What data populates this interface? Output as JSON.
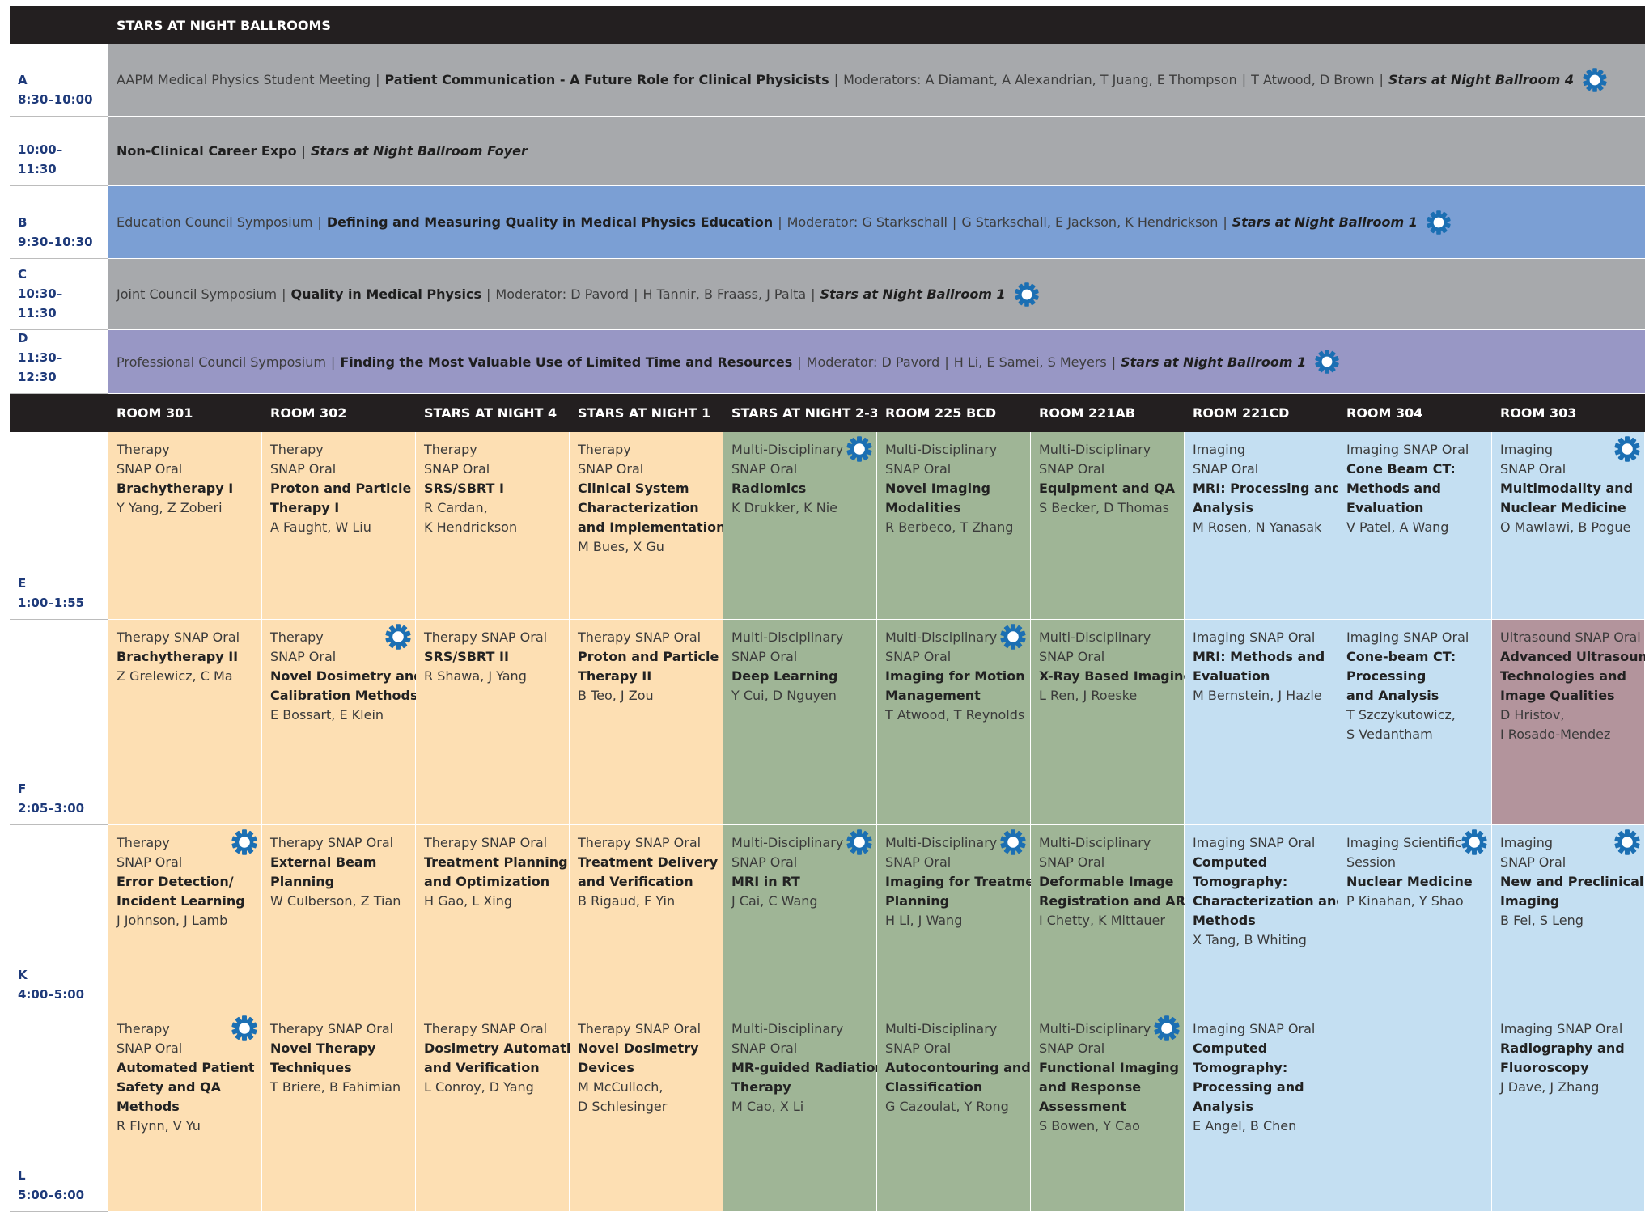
{
  "header": {
    "title": "STARS AT NIGHT BALLROOMS"
  },
  "colors": {
    "header_bg": "#231f20",
    "time_text": "#1e3a7a",
    "grey_band": "#a7a9ac",
    "blue_band": "#7b9fd4",
    "purple_band": "#9897c5",
    "therapy": "#fddfb3",
    "multidisciplinary": "#9fb596",
    "imaging": "#c4dff2",
    "ultrasound": "#b3949c",
    "gear": "#1b6fb3"
  },
  "time_slots": [
    {
      "letter": "A",
      "time": "8:30–10:00"
    },
    {
      "letter": "",
      "time": "10:00–11:30"
    },
    {
      "letter": "B",
      "time": "9:30–10:30"
    },
    {
      "letter": "C",
      "time": "10:30–11:30"
    },
    {
      "letter": "D",
      "time": "11:30–12:30"
    },
    {
      "letter": "E",
      "time": "1:00–1:55"
    },
    {
      "letter": "F",
      "time": "2:05–3:00"
    },
    {
      "letter": "K",
      "time": "4:00–5:00"
    },
    {
      "letter": "L",
      "time": "5:00–6:00"
    }
  ],
  "bands": [
    {
      "type": "AAPM Medical Physics Student Meeting",
      "title": "Patient Communication - A Future Role for Clinical Physicists",
      "moderator": "Moderators: A Diamant, A Alexandrian, T Juang, E Thompson",
      "speakers": "T Atwood, D Brown",
      "location": "Stars at Night Ballroom 4",
      "gear": true
    },
    {
      "type": "",
      "title": "Non-Clinical Career Expo",
      "moderator": "",
      "speakers": "",
      "location": "Stars at Night Ballroom Foyer",
      "gear": false
    },
    {
      "type": "Education Council Symposium",
      "title": "Defining and Measuring Quality in Medical Physics Education",
      "moderator": "Moderator: G Starkschall",
      "speakers": "G Starkschall, E Jackson, K Hendrickson",
      "location": "Stars at Night Ballroom 1",
      "gear": true
    },
    {
      "type": "Joint Council Symposium",
      "title": "Quality in Medical Physics",
      "moderator": "Moderator: D Pavord",
      "speakers": "H Tannir, B Fraass, J Palta",
      "location": "Stars at Night Ballroom 1",
      "gear": true
    },
    {
      "type": "Professional Council Symposium",
      "title": "Finding the Most Valuable Use of Limited Time and Resources",
      "moderator": "Moderator: D Pavord",
      "speakers": "H Li, E Samei, S Meyers",
      "location": "Stars at Night Ballroom 1",
      "gear": true
    }
  ],
  "rooms": [
    "ROOM 301",
    "ROOM 302",
    "STARS AT NIGHT 4",
    "STARS AT NIGHT 1",
    "STARS AT NIGHT 2-3",
    "ROOM 225 BCD",
    "ROOM 221AB",
    "ROOM 221CD",
    "ROOM 304",
    "ROOM 303"
  ],
  "sessions": [
    {
      "row": 0,
      "col": 0,
      "cat": "therapy",
      "gear": false,
      "type": [
        "Therapy",
        "SNAP Oral"
      ],
      "title": [
        "Brachytherapy I"
      ],
      "speakers": [
        "Y Yang, Z Zoberi"
      ]
    },
    {
      "row": 0,
      "col": 1,
      "cat": "therapy",
      "gear": false,
      "type": [
        "Therapy",
        "SNAP Oral"
      ],
      "title": [
        "Proton and Particle",
        "Therapy I"
      ],
      "speakers": [
        "A Faught, W Liu"
      ]
    },
    {
      "row": 0,
      "col": 2,
      "cat": "therapy",
      "gear": false,
      "type": [
        "Therapy",
        "SNAP Oral"
      ],
      "title": [
        "SRS/SBRT I"
      ],
      "speakers": [
        "R Cardan,",
        "K Hendrickson"
      ]
    },
    {
      "row": 0,
      "col": 3,
      "cat": "therapy",
      "gear": false,
      "type": [
        "Therapy",
        "SNAP Oral"
      ],
      "title": [
        "Clinical System",
        "Characterization",
        "and Implementation"
      ],
      "speakers": [
        "M Bues, X Gu"
      ]
    },
    {
      "row": 0,
      "col": 4,
      "cat": "multidisciplinary",
      "gear": true,
      "type": [
        "Multi-Disciplinary",
        "SNAP Oral"
      ],
      "title": [
        "Radiomics"
      ],
      "speakers": [
        "K Drukker, K Nie"
      ]
    },
    {
      "row": 0,
      "col": 5,
      "cat": "multidisciplinary",
      "gear": false,
      "type": [
        "Multi-Disciplinary",
        "SNAP Oral"
      ],
      "title": [
        "Novel Imaging",
        "Modalities"
      ],
      "speakers": [
        "R Berbeco, T Zhang"
      ]
    },
    {
      "row": 0,
      "col": 6,
      "cat": "multidisciplinary",
      "gear": false,
      "type": [
        "Multi-Disciplinary",
        "SNAP Oral"
      ],
      "title": [
        "Equipment and QA"
      ],
      "speakers": [
        "S Becker, D Thomas"
      ]
    },
    {
      "row": 0,
      "col": 7,
      "cat": "imaging",
      "gear": false,
      "type": [
        "Imaging",
        "SNAP Oral"
      ],
      "title": [
        "MRI: Processing and",
        "Analysis"
      ],
      "speakers": [
        "M Rosen, N Yanasak"
      ]
    },
    {
      "row": 0,
      "col": 8,
      "cat": "imaging",
      "gear": false,
      "type": [
        "Imaging SNAP Oral"
      ],
      "title": [
        "Cone Beam CT:",
        "Methods and",
        "Evaluation"
      ],
      "speakers": [
        "V Patel, A Wang"
      ]
    },
    {
      "row": 0,
      "col": 9,
      "cat": "imaging",
      "gear": true,
      "type": [
        "Imaging",
        "SNAP Oral"
      ],
      "title": [
        "Multimodality and",
        "Nuclear Medicine"
      ],
      "speakers": [
        "O Mawlawi, B Pogue"
      ]
    },
    {
      "row": 1,
      "col": 0,
      "cat": "therapy",
      "gear": false,
      "type": [
        "Therapy SNAP Oral"
      ],
      "title": [
        "Brachytherapy II"
      ],
      "speakers": [
        "Z Grelewicz, C Ma"
      ]
    },
    {
      "row": 1,
      "col": 1,
      "cat": "therapy",
      "gear": true,
      "type": [
        "Therapy",
        "SNAP Oral"
      ],
      "title": [
        "Novel Dosimetry and",
        "Calibration Methods"
      ],
      "speakers": [
        "E Bossart, E Klein"
      ]
    },
    {
      "row": 1,
      "col": 2,
      "cat": "therapy",
      "gear": false,
      "type": [
        "Therapy SNAP Oral"
      ],
      "title": [
        "SRS/SBRT II"
      ],
      "speakers": [
        "R Shawa, J Yang"
      ]
    },
    {
      "row": 1,
      "col": 3,
      "cat": "therapy",
      "gear": false,
      "type": [
        "Therapy SNAP Oral"
      ],
      "title": [
        "Proton and Particle",
        "Therapy II"
      ],
      "speakers": [
        "B Teo, J Zou"
      ]
    },
    {
      "row": 1,
      "col": 4,
      "cat": "multidisciplinary",
      "gear": false,
      "type": [
        "Multi-Disciplinary",
        "SNAP Oral"
      ],
      "title": [
        "Deep Learning"
      ],
      "speakers": [
        "Y Cui, D Nguyen"
      ]
    },
    {
      "row": 1,
      "col": 5,
      "cat": "multidisciplinary",
      "gear": true,
      "type": [
        "Multi-Disciplinary",
        "SNAP Oral"
      ],
      "title": [
        "Imaging for Motion",
        "Management"
      ],
      "speakers": [
        "T Atwood, T Reynolds"
      ]
    },
    {
      "row": 1,
      "col": 6,
      "cat": "multidisciplinary",
      "gear": false,
      "type": [
        "Multi-Disciplinary",
        "SNAP Oral"
      ],
      "title": [
        "X-Ray Based Imaging"
      ],
      "speakers": [
        "L Ren, J Roeske"
      ]
    },
    {
      "row": 1,
      "col": 7,
      "cat": "imaging",
      "gear": false,
      "type": [
        "Imaging SNAP Oral"
      ],
      "title": [
        "MRI: Methods and",
        "Evaluation"
      ],
      "speakers": [
        "M Bernstein, J Hazle"
      ]
    },
    {
      "row": 1,
      "col": 8,
      "cat": "imaging",
      "gear": false,
      "type": [
        "Imaging SNAP Oral"
      ],
      "title": [
        "Cone-beam CT:",
        "Processing",
        "and Analysis"
      ],
      "speakers": [
        "T Szczykutowicz,",
        "S Vedantham"
      ]
    },
    {
      "row": 1,
      "col": 9,
      "cat": "ultrasound",
      "gear": false,
      "type": [
        "Ultrasound SNAP Oral"
      ],
      "title": [
        "Advanced Ultrasound",
        "Technologies and",
        "Image Qualities"
      ],
      "speakers": [
        "D Hristov,",
        "I Rosado-Mendez"
      ]
    },
    {
      "row": 2,
      "col": 0,
      "cat": "therapy",
      "gear": true,
      "type": [
        "Therapy",
        "SNAP Oral"
      ],
      "title": [
        "Error Detection/",
        "Incident Learning"
      ],
      "speakers": [
        "J Johnson, J Lamb"
      ]
    },
    {
      "row": 2,
      "col": 1,
      "cat": "therapy",
      "gear": false,
      "type": [
        "Therapy SNAP Oral"
      ],
      "title": [
        "External Beam",
        "Planning"
      ],
      "speakers": [
        "W Culberson, Z Tian"
      ]
    },
    {
      "row": 2,
      "col": 2,
      "cat": "therapy",
      "gear": false,
      "type": [
        "Therapy SNAP Oral"
      ],
      "title": [
        "Treatment Planning",
        "and Optimization"
      ],
      "speakers": [
        "H Gao, L Xing"
      ]
    },
    {
      "row": 2,
      "col": 3,
      "cat": "therapy",
      "gear": false,
      "type": [
        "Therapy SNAP Oral"
      ],
      "title": [
        "Treatment Delivery",
        "and Verification"
      ],
      "speakers": [
        "B Rigaud, F Yin"
      ]
    },
    {
      "row": 2,
      "col": 4,
      "cat": "multidisciplinary",
      "gear": true,
      "type": [
        "Multi-Disciplinary",
        "SNAP Oral"
      ],
      "title": [
        "MRI in RT"
      ],
      "speakers": [
        "J Cai, C Wang"
      ]
    },
    {
      "row": 2,
      "col": 5,
      "cat": "multidisciplinary",
      "gear": true,
      "type": [
        "Multi-Disciplinary",
        "SNAP Oral"
      ],
      "title": [
        "Imaging for Treatment",
        "Planning"
      ],
      "speakers": [
        "H Li, J Wang"
      ]
    },
    {
      "row": 2,
      "col": 6,
      "cat": "multidisciplinary",
      "gear": false,
      "type": [
        "Multi-Disciplinary",
        "SNAP Oral"
      ],
      "title": [
        "Deformable Image",
        "Registration and ART"
      ],
      "speakers": [
        "I Chetty, K Mittauer"
      ]
    },
    {
      "row": 2,
      "col": 7,
      "cat": "imaging",
      "gear": false,
      "type": [
        "Imaging SNAP Oral"
      ],
      "title": [
        "Computed",
        "Tomography:",
        "Characterization and",
        "Methods"
      ],
      "speakers": [
        "X Tang, B Whiting"
      ]
    },
    {
      "row": 2,
      "col": 8,
      "cat": "imaging",
      "gear": true,
      "span": 2,
      "type": [
        "Imaging Scientific",
        "Session"
      ],
      "title": [
        "Nuclear Medicine"
      ],
      "speakers": [
        "P Kinahan, Y Shao"
      ]
    },
    {
      "row": 2,
      "col": 9,
      "cat": "imaging",
      "gear": true,
      "type": [
        "Imaging",
        "SNAP Oral"
      ],
      "title": [
        "New and Preclinical",
        "Imaging"
      ],
      "speakers": [
        "B Fei, S Leng"
      ]
    },
    {
      "row": 3,
      "col": 0,
      "cat": "therapy",
      "gear": true,
      "type": [
        "Therapy",
        "SNAP Oral"
      ],
      "title": [
        "Automated Patient",
        "Safety and QA",
        "Methods"
      ],
      "speakers": [
        "R Flynn, V Yu"
      ]
    },
    {
      "row": 3,
      "col": 1,
      "cat": "therapy",
      "gear": false,
      "type": [
        "Therapy SNAP Oral"
      ],
      "title": [
        "Novel Therapy",
        "Techniques"
      ],
      "speakers": [
        "T Briere, B Fahimian"
      ]
    },
    {
      "row": 3,
      "col": 2,
      "cat": "therapy",
      "gear": false,
      "type": [
        "Therapy SNAP Oral"
      ],
      "title": [
        "Dosimetry Automation",
        "and Verification"
      ],
      "speakers": [
        "L Conroy, D Yang"
      ]
    },
    {
      "row": 3,
      "col": 3,
      "cat": "therapy",
      "gear": false,
      "type": [
        "Therapy SNAP Oral"
      ],
      "title": [
        "Novel Dosimetry",
        "Devices"
      ],
      "speakers": [
        "M McCulloch,",
        "D Schlesinger"
      ]
    },
    {
      "row": 3,
      "col": 4,
      "cat": "multidisciplinary",
      "gear": false,
      "type": [
        "Multi-Disciplinary",
        "SNAP Oral"
      ],
      "title": [
        "MR-guided Radiation",
        "Therapy"
      ],
      "speakers": [
        "M Cao, X Li"
      ]
    },
    {
      "row": 3,
      "col": 5,
      "cat": "multidisciplinary",
      "gear": false,
      "type": [
        "Multi-Disciplinary",
        "SNAP Oral"
      ],
      "title": [
        "Autocontouring and",
        "Classification"
      ],
      "speakers": [
        "G Cazoulat, Y Rong"
      ]
    },
    {
      "row": 3,
      "col": 6,
      "cat": "multidisciplinary",
      "gear": true,
      "type": [
        "Multi-Disciplinary",
        "SNAP Oral"
      ],
      "title": [
        "Functional Imaging",
        "and Response",
        "Assessment"
      ],
      "speakers": [
        "S Bowen, Y Cao"
      ]
    },
    {
      "row": 3,
      "col": 7,
      "cat": "imaging",
      "gear": false,
      "type": [
        "Imaging SNAP Oral"
      ],
      "title": [
        "Computed",
        "Tomography:",
        "Processing and",
        "Analysis"
      ],
      "speakers": [
        "E Angel, B Chen"
      ]
    },
    {
      "row": 3,
      "col": 9,
      "cat": "imaging",
      "gear": false,
      "type": [
        "Imaging SNAP Oral"
      ],
      "title": [
        "Radiography and",
        "Fluoroscopy"
      ],
      "speakers": [
        "J Dave, J Zhang"
      ]
    }
  ]
}
